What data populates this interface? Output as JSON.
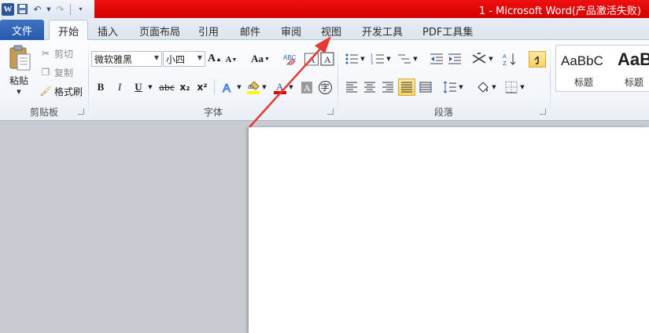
{
  "window": {
    "title": "1  -  Microsoft Word(产品激活失败)"
  },
  "qat": {
    "app_icon": "W"
  },
  "tabs": {
    "file": "文件",
    "items": [
      "开始",
      "插入",
      "页面布局",
      "引用",
      "邮件",
      "审阅",
      "视图",
      "开发工具",
      "PDF工具集"
    ]
  },
  "clipboard": {
    "paste": "粘贴",
    "cut": "剪切",
    "copy": "复制",
    "format_painter": "格式刷",
    "label": "剪贴板"
  },
  "font": {
    "name": "微软雅黑",
    "size": "小四",
    "label": "字体",
    "grow": "A",
    "shrink": "A",
    "case": "Aa",
    "bold": "B",
    "italic": "I",
    "underline": "U",
    "strike": "abc",
    "sub": "x₂",
    "sup": "x²",
    "phonetic": "字"
  },
  "paragraph": {
    "label": "段落"
  },
  "styles": {
    "items": [
      {
        "sample": "AaBbC",
        "name": "标题"
      },
      {
        "sample": "AaB",
        "name": "标题"
      }
    ]
  },
  "colors": {
    "title_red": "#e00000",
    "file_tab": "#2f63b2",
    "annotation_arrow": "#e53935"
  }
}
